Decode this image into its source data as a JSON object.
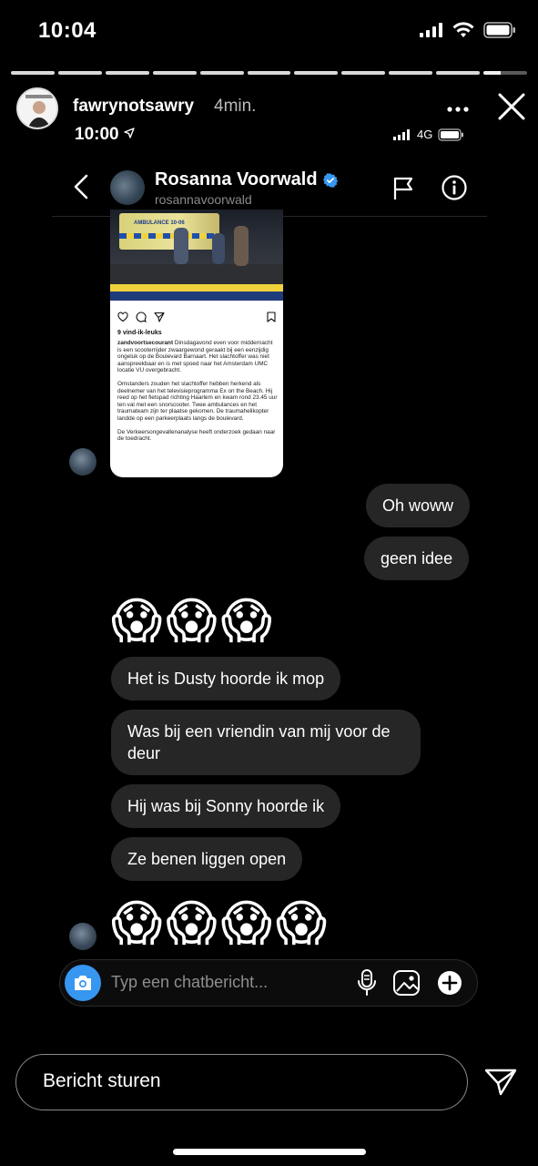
{
  "status_bar": {
    "time": "10:04"
  },
  "story": {
    "username": "fawrynotsawry",
    "time_ago": "4min.",
    "segments_total": 11,
    "segments_done": 10,
    "current_progress": 0.4
  },
  "inner_status": {
    "time": "10:00",
    "network": "4G"
  },
  "dm": {
    "name": "Rosanna Voorwald",
    "handle": "rosannavoorwald",
    "verified": true
  },
  "post": {
    "ambulance_label": "AMBULANCE 10-06",
    "likes": "9 vind-ik-leuks",
    "caption_user": "zandvoortsecourant",
    "caption_1": " Dinsdagavond even voor middernacht is een scooterrijder zwaargewond geraakt bij een eenzijdig ongeluk op de Boulevard Barnaart. Het slachtoffer was niet aanspreekbaar en is met spoed naar het Amsterdam UMC locatie VU overgebracht.",
    "caption_2": "Omstanders zouden het slachtoffer hebben herkend als deelnemer van het televisieprogramma Ex on the Beach. Hij reed op het fietspad richting Haarlem en kwam rond 23.45 uur ten val met een snorscooter. Twee ambulances en het traumateam zijn ter plaatse gekomen. De traumahelikopter landde op een parkeerplaats langs de boulevard.",
    "caption_3": "De Verkeersongevallenanalyse heeft onderzoek gedaan naar de toedracht."
  },
  "messages": {
    "me_1": "Oh woww",
    "me_2": "geen idee",
    "them_1": "Het is Dusty hoorde ik mop",
    "them_2": "Was bij een vriendin van mij voor de deur",
    "them_3": "Hij was bij Sonny hoorde ik",
    "them_4": "Ze benen liggen open",
    "emoji_1": "😱😱😱",
    "emoji_2": "😱😱😱😱"
  },
  "composer": {
    "placeholder": "Typ een chatbericht..."
  },
  "reply": {
    "placeholder": "Bericht sturen"
  },
  "colors": {
    "accent": "#3797f0",
    "bubble": "#262626",
    "background": "#000000"
  },
  "icons": [
    "signal-icon",
    "wifi-icon",
    "battery-icon",
    "more-icon",
    "close-icon",
    "location-arrow-icon",
    "back-icon",
    "verified-badge-icon",
    "flag-icon",
    "info-icon",
    "heart-icon",
    "comment-icon",
    "share-icon",
    "bookmark-icon",
    "camera-icon",
    "microphone-icon",
    "image-icon",
    "plus-icon",
    "send-icon"
  ]
}
